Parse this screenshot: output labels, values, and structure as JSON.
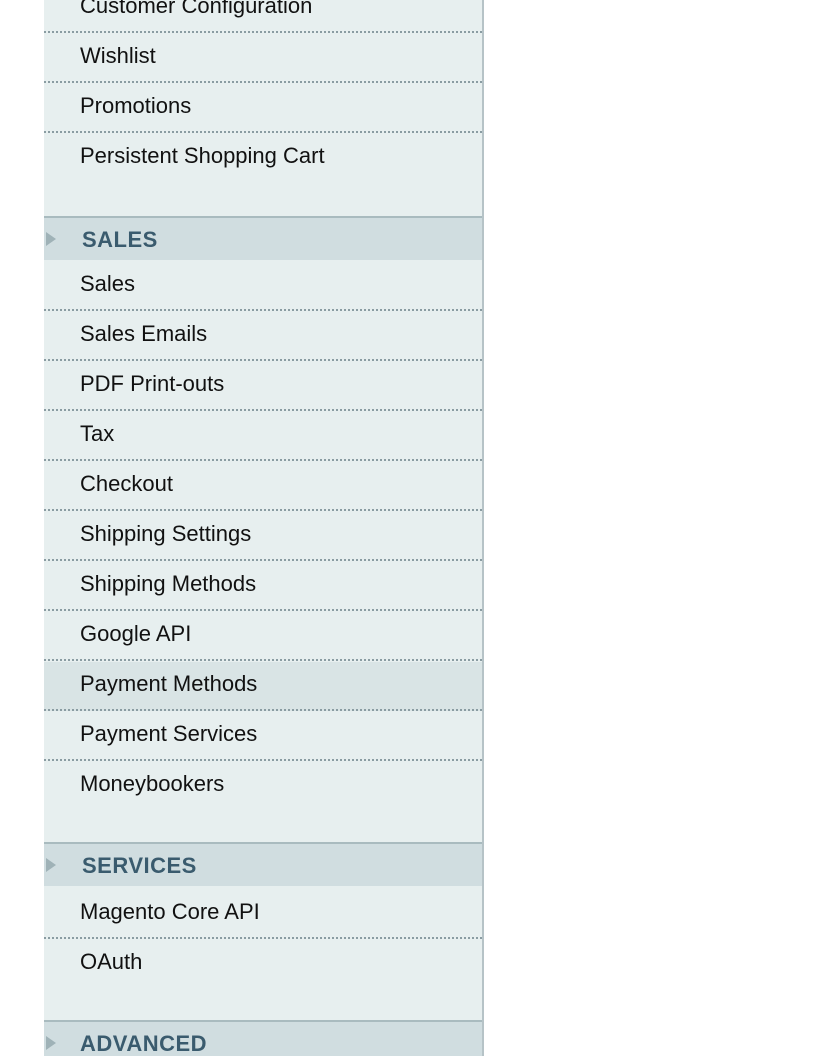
{
  "customers_group": {
    "items": [
      {
        "label": "Customer Configuration"
      },
      {
        "label": "Wishlist"
      },
      {
        "label": "Promotions"
      },
      {
        "label": "Persistent Shopping Cart"
      }
    ]
  },
  "sales_section": {
    "header": "SALES",
    "items": [
      {
        "label": "Sales"
      },
      {
        "label": "Sales Emails"
      },
      {
        "label": "PDF Print-outs"
      },
      {
        "label": "Tax"
      },
      {
        "label": "Checkout"
      },
      {
        "label": "Shipping Settings"
      },
      {
        "label": "Shipping Methods"
      },
      {
        "label": "Google API"
      },
      {
        "label": "Payment Methods",
        "active": true
      },
      {
        "label": "Payment Services"
      },
      {
        "label": "Moneybookers"
      }
    ]
  },
  "services_section": {
    "header": "SERVICES",
    "items": [
      {
        "label": "Magento Core API"
      },
      {
        "label": "OAuth"
      }
    ]
  },
  "advanced_section": {
    "header": "ADVANCED"
  },
  "icons": {
    "section_toggle": "triangle-right-icon"
  }
}
